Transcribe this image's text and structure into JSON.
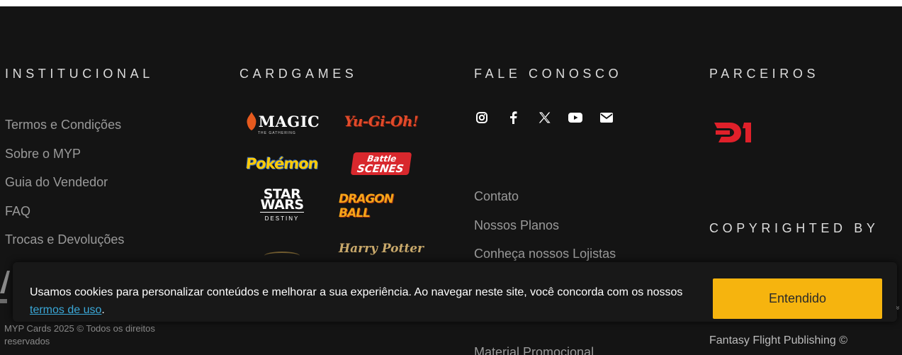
{
  "institucional": {
    "heading": "INSTITUCIONAL",
    "links": [
      "Termos e Condições",
      "Sobre o MYP",
      "Guia do Vendedor",
      "FAQ",
      "Trocas e Devoluções"
    ],
    "copyright": "MYP Cards 2025 © Todos os direitos reservados"
  },
  "cardgames": {
    "heading": "CARDGAMES",
    "logos": {
      "magic": "MAGIC",
      "magic_sub": "THE GATHERING",
      "yugioh": "Yu-Gi-Oh!",
      "pokemon": "Pokémon",
      "battle_1": "Battle",
      "battle_2": "SCENES",
      "starwars_1": "STAR",
      "starwars_2": "WARS",
      "starwars_3": "DESTINY",
      "dragonball": "DRAGON BALL",
      "harrypotter": "Harry Potter"
    }
  },
  "fale": {
    "heading": "FALE CONOSCO",
    "social": [
      "instagram-icon",
      "facebook-icon",
      "x-icon",
      "youtube-icon",
      "email-icon"
    ],
    "links": [
      "Contato",
      "Nossos Planos",
      "Conheça nossos Lojistas"
    ],
    "cut_link": "Material Promocional"
  },
  "parceiros": {
    "heading": "PARCEIROS",
    "copyright_heading": "COPYRIGHTED BY",
    "ffp": "Fantasy Flight Publishing ©"
  },
  "cookie": {
    "text": "Usamos cookies para personalizar conteúdos e melhorar a sua experiência. Ao navegar neste site, você concorda com os nossos ",
    "link": "termos de uso",
    "tail": ".",
    "button": "Entendido"
  },
  "colors": {
    "background": "#141414",
    "accent": "#f6b40e",
    "link": "#3aa8d8",
    "partner": "#e0202a"
  }
}
